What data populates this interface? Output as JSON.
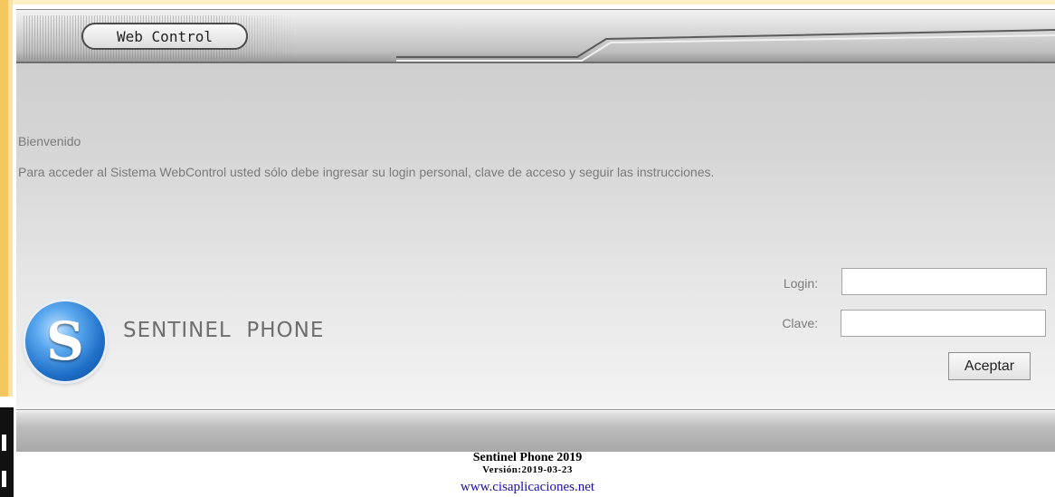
{
  "header": {
    "title": "Web Control"
  },
  "intro": {
    "welcome": "Bienvenido",
    "instructions": "Para acceder al Sistema WebControl usted sólo debe ingresar su login personal, clave de acceso y seguir las instrucciones."
  },
  "brand": {
    "logo_letter": "S",
    "name": "SENTINEL  PHONE"
  },
  "form": {
    "login_label": "Login:",
    "login_value": "",
    "password_label": "Clave:",
    "password_value": "",
    "submit_label": "Aceptar"
  },
  "footer": {
    "title": "Sentinel Phone 2019",
    "version": "Versión:2019-03-23",
    "link": "www.cisaplicaciones.net"
  },
  "colors": {
    "frame": "#f5c560",
    "logo_blue": "#1f6fc8",
    "link": "#1a0dab"
  }
}
